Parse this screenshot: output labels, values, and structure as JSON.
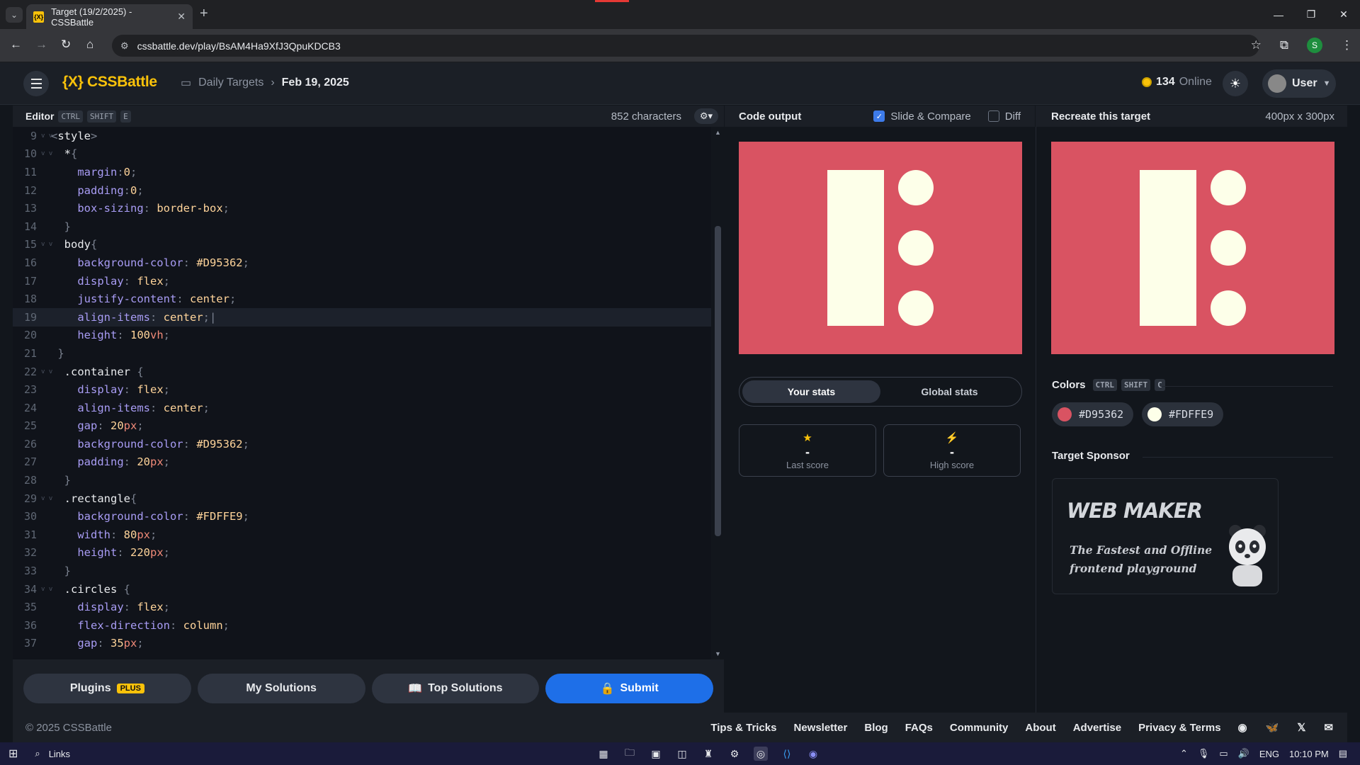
{
  "browser": {
    "tab_title": "Target (19/2/2025) - CSSBattle",
    "favicon_text": "{X}",
    "url": "cssbattle.dev/play/BsAM4Ha9XfJ3QpuKDCB3",
    "profile_initial": "S"
  },
  "header": {
    "logo": "{X} CSSBattle",
    "breadcrumb_section": "Daily Targets",
    "breadcrumb_date": "Feb 19, 2025",
    "online_count": "134",
    "online_label": "Online",
    "user_label": "User"
  },
  "editor": {
    "title": "Editor",
    "shortcut": [
      "CTRL",
      "SHIFT",
      "E"
    ],
    "char_count": "852 characters",
    "lines": [
      {
        "n": "9",
        "fold": "v v",
        "segs": [
          [
            "c-punc",
            "<"
          ],
          [
            "c-tag",
            "style"
          ],
          [
            "c-punc",
            ">"
          ]
        ]
      },
      {
        "n": "10",
        "fold": "v v",
        "segs": [
          [
            "c-sel",
            "  *"
          ],
          [
            "c-punc",
            "{"
          ]
        ]
      },
      {
        "n": "11",
        "fold": "",
        "segs": [
          [
            "c-prop",
            "    margin"
          ],
          [
            "c-punc",
            ":"
          ],
          [
            "c-num",
            "0"
          ],
          [
            "c-punc",
            ";"
          ]
        ]
      },
      {
        "n": "12",
        "fold": "",
        "segs": [
          [
            "c-prop",
            "    padding"
          ],
          [
            "c-punc",
            ":"
          ],
          [
            "c-num",
            "0"
          ],
          [
            "c-punc",
            ";"
          ]
        ]
      },
      {
        "n": "13",
        "fold": "",
        "segs": [
          [
            "c-prop",
            "    box-sizing"
          ],
          [
            "c-punc",
            ": "
          ],
          [
            "c-val",
            "border-box"
          ],
          [
            "c-punc",
            ";"
          ]
        ]
      },
      {
        "n": "14",
        "fold": "",
        "segs": [
          [
            "c-punc",
            "  }"
          ]
        ]
      },
      {
        "n": "15",
        "fold": "v v",
        "segs": [
          [
            "c-sel",
            "  body"
          ],
          [
            "c-punc",
            "{"
          ]
        ]
      },
      {
        "n": "16",
        "fold": "",
        "segs": [
          [
            "c-prop",
            "    background-color"
          ],
          [
            "c-punc",
            ": "
          ],
          [
            "c-val",
            "#D95362"
          ],
          [
            "c-punc",
            ";"
          ]
        ]
      },
      {
        "n": "17",
        "fold": "",
        "segs": [
          [
            "c-prop",
            "    display"
          ],
          [
            "c-punc",
            ": "
          ],
          [
            "c-val",
            "flex"
          ],
          [
            "c-punc",
            ";"
          ]
        ]
      },
      {
        "n": "18",
        "fold": "",
        "segs": [
          [
            "c-prop",
            "    justify-content"
          ],
          [
            "c-punc",
            ": "
          ],
          [
            "c-val",
            "center"
          ],
          [
            "c-punc",
            ";"
          ]
        ]
      },
      {
        "n": "19",
        "fold": "",
        "active": true,
        "segs": [
          [
            "c-prop",
            "    align-items"
          ],
          [
            "c-punc",
            ": "
          ],
          [
            "c-val",
            "center"
          ],
          [
            "c-punc",
            ";|"
          ]
        ]
      },
      {
        "n": "20",
        "fold": "",
        "segs": [
          [
            "c-prop",
            "    height"
          ],
          [
            "c-punc",
            ": "
          ],
          [
            "c-num",
            "100"
          ],
          [
            "c-unit",
            "vh"
          ],
          [
            "c-punc",
            ";"
          ]
        ]
      },
      {
        "n": "21",
        "fold": "",
        "segs": [
          [
            "c-punc",
            " }"
          ]
        ]
      },
      {
        "n": "22",
        "fold": "v v",
        "segs": [
          [
            "c-sel",
            "  .container "
          ],
          [
            "c-punc",
            "{"
          ]
        ]
      },
      {
        "n": "23",
        "fold": "",
        "segs": [
          [
            "c-prop",
            "    display"
          ],
          [
            "c-punc",
            ": "
          ],
          [
            "c-val",
            "flex"
          ],
          [
            "c-punc",
            ";"
          ]
        ]
      },
      {
        "n": "24",
        "fold": "",
        "segs": [
          [
            "c-prop",
            "    align-items"
          ],
          [
            "c-punc",
            ": "
          ],
          [
            "c-val",
            "center"
          ],
          [
            "c-punc",
            ";"
          ]
        ]
      },
      {
        "n": "25",
        "fold": "",
        "segs": [
          [
            "c-prop",
            "    gap"
          ],
          [
            "c-punc",
            ": "
          ],
          [
            "c-num",
            "20"
          ],
          [
            "c-unit",
            "px"
          ],
          [
            "c-punc",
            ";"
          ]
        ]
      },
      {
        "n": "26",
        "fold": "",
        "segs": [
          [
            "c-prop",
            "    background-color"
          ],
          [
            "c-punc",
            ": "
          ],
          [
            "c-val",
            "#D95362"
          ],
          [
            "c-punc",
            ";"
          ]
        ]
      },
      {
        "n": "27",
        "fold": "",
        "segs": [
          [
            "c-prop",
            "    padding"
          ],
          [
            "c-punc",
            ": "
          ],
          [
            "c-num",
            "20"
          ],
          [
            "c-unit",
            "px"
          ],
          [
            "c-punc",
            ";"
          ]
        ]
      },
      {
        "n": "28",
        "fold": "",
        "segs": [
          [
            "c-punc",
            "  }"
          ]
        ]
      },
      {
        "n": "29",
        "fold": "v v",
        "segs": [
          [
            "c-sel",
            "  .rectangle"
          ],
          [
            "c-punc",
            "{"
          ]
        ]
      },
      {
        "n": "30",
        "fold": "",
        "segs": [
          [
            "c-prop",
            "    background-color"
          ],
          [
            "c-punc",
            ": "
          ],
          [
            "c-val",
            "#FDFFE9"
          ],
          [
            "c-punc",
            ";"
          ]
        ]
      },
      {
        "n": "31",
        "fold": "",
        "segs": [
          [
            "c-prop",
            "    width"
          ],
          [
            "c-punc",
            ": "
          ],
          [
            "c-num",
            "80"
          ],
          [
            "c-unit",
            "px"
          ],
          [
            "c-punc",
            ";"
          ]
        ]
      },
      {
        "n": "32",
        "fold": "",
        "segs": [
          [
            "c-prop",
            "    height"
          ],
          [
            "c-punc",
            ": "
          ],
          [
            "c-num",
            "220"
          ],
          [
            "c-unit",
            "px"
          ],
          [
            "c-punc",
            ";"
          ]
        ]
      },
      {
        "n": "33",
        "fold": "",
        "segs": [
          [
            "c-punc",
            "  }"
          ]
        ]
      },
      {
        "n": "34",
        "fold": "v v",
        "segs": [
          [
            "c-sel",
            "  .circles "
          ],
          [
            "c-punc",
            "{"
          ]
        ]
      },
      {
        "n": "35",
        "fold": "",
        "segs": [
          [
            "c-prop",
            "    display"
          ],
          [
            "c-punc",
            ": "
          ],
          [
            "c-val",
            "flex"
          ],
          [
            "c-punc",
            ";"
          ]
        ]
      },
      {
        "n": "36",
        "fold": "",
        "segs": [
          [
            "c-prop",
            "    flex-direction"
          ],
          [
            "c-punc",
            ": "
          ],
          [
            "c-val",
            "column"
          ],
          [
            "c-punc",
            ";"
          ]
        ]
      },
      {
        "n": "37",
        "fold": "",
        "segs": [
          [
            "c-prop",
            "    gap"
          ],
          [
            "c-punc",
            ": "
          ],
          [
            "c-num",
            "35"
          ],
          [
            "c-unit",
            "px"
          ],
          [
            "c-punc",
            ";"
          ]
        ]
      }
    ],
    "actions": {
      "plugins": "Plugins",
      "plugins_badge": "PLUS",
      "my_solutions": "My Solutions",
      "top_solutions": "Top Solutions",
      "submit": "Submit"
    }
  },
  "output": {
    "title": "Code output",
    "slide_compare": "Slide & Compare",
    "slide_compare_checked": true,
    "diff": "Diff",
    "diff_checked": false,
    "tabs": [
      "Your stats",
      "Global stats"
    ],
    "last_score_value": "-",
    "last_score_label": "Last score",
    "high_score_value": "-",
    "high_score_label": "High score"
  },
  "target": {
    "title": "Recreate this target",
    "dimensions": "400px x 300px",
    "colors_title": "Colors",
    "colors_shortcut": [
      "CTRL",
      "SHIFT",
      "C"
    ],
    "colors": [
      "#D95362",
      "#FDFFE9"
    ],
    "sponsor_title": "Target Sponsor",
    "sponsor_logo": "WEB MAKER",
    "sponsor_tagline": "The Fastest and Offline frontend playground"
  },
  "footer": {
    "copyright": "© 2025 CSSBattle",
    "links": [
      "Tips & Tricks",
      "Newsletter",
      "Blog",
      "FAQs",
      "Community",
      "About",
      "Advertise",
      "Privacy & Terms"
    ]
  },
  "taskbar": {
    "search_label": "Links",
    "language": "ENG",
    "time": "10:10 PM"
  }
}
